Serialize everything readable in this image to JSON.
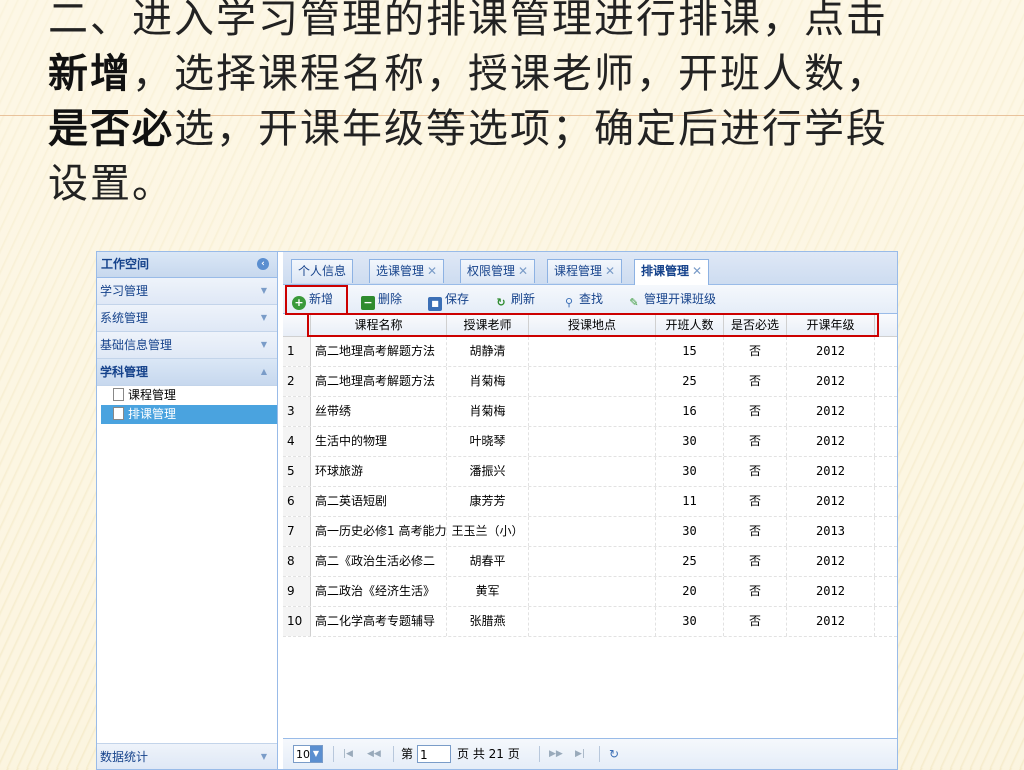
{
  "slide": {
    "line1": "二、进入学习管理的排课管理进行排课，点击",
    "bold_new": "新增",
    "line2_rest": "，选择课程名称，授课老师，开班人数，",
    "bold_required": "是否必",
    "line3_rest": "选，开课年级等选项；确定后进行学段",
    "line4": "设置。"
  },
  "sidebar": {
    "title": "工作空间",
    "sections": [
      {
        "label": "学习管理"
      },
      {
        "label": "系统管理"
      },
      {
        "label": "基础信息管理"
      },
      {
        "label": "学科管理"
      }
    ],
    "items": [
      {
        "label": "课程管理"
      },
      {
        "label": "排课管理"
      }
    ],
    "bottom": "数据统计"
  },
  "tabs": [
    {
      "label": "个人信息"
    },
    {
      "label": "选课管理"
    },
    {
      "label": "权限管理"
    },
    {
      "label": "课程管理"
    },
    {
      "label": "排课管理"
    }
  ],
  "toolbar": {
    "add": "新增",
    "delete": "删除",
    "save": "保存",
    "refresh": "刷新",
    "search": "查找",
    "manage": "管理开课班级"
  },
  "grid": {
    "columns": [
      "课程名称",
      "授课老师",
      "授课地点",
      "开班人数",
      "是否必选",
      "开课年级"
    ],
    "rows": [
      {
        "n": "1",
        "name": "高二地理高考解题方法",
        "teacher": "胡静清",
        "place": "",
        "count": "15",
        "req": "否",
        "grade": "2012"
      },
      {
        "n": "2",
        "name": "高二地理高考解题方法",
        "teacher": "肖菊梅",
        "place": "",
        "count": "25",
        "req": "否",
        "grade": "2012"
      },
      {
        "n": "3",
        "name": "丝带绣",
        "teacher": "肖菊梅",
        "place": "",
        "count": "16",
        "req": "否",
        "grade": "2012"
      },
      {
        "n": "4",
        "name": "生活中的物理",
        "teacher": "叶晓琴",
        "place": "",
        "count": "30",
        "req": "否",
        "grade": "2012"
      },
      {
        "n": "5",
        "name": "环球旅游",
        "teacher": "潘振兴",
        "place": "",
        "count": "30",
        "req": "否",
        "grade": "2012"
      },
      {
        "n": "6",
        "name": "高二英语短剧",
        "teacher": "康芳芳",
        "place": "",
        "count": "11",
        "req": "否",
        "grade": "2012"
      },
      {
        "n": "7",
        "name": "高一历史必修1 高考能力",
        "teacher": "王玉兰（小）",
        "place": "",
        "count": "30",
        "req": "否",
        "grade": "2013"
      },
      {
        "n": "8",
        "name": "高二《政治生活必修二",
        "teacher": "胡春平",
        "place": "",
        "count": "25",
        "req": "否",
        "grade": "2012"
      },
      {
        "n": "9",
        "name": "高二政治《经济生活》",
        "teacher": "黄军",
        "place": "",
        "count": "20",
        "req": "否",
        "grade": "2012"
      },
      {
        "n": "10",
        "name": "高二化学高考专题辅导",
        "teacher": "张腊燕",
        "place": "",
        "count": "30",
        "req": "否",
        "grade": "2012"
      }
    ]
  },
  "pager": {
    "page_size": "10",
    "page_prefix": "第",
    "page_value": "1",
    "page_suffix": "页 共 21 页"
  },
  "colors": {
    "highlight": "#cc0000",
    "accent": "#4aa3df"
  },
  "icons": [
    "add-icon",
    "delete-icon",
    "save-icon",
    "refresh-icon",
    "search-icon",
    "edit-icon",
    "document-icon",
    "chevron-down-icon",
    "collapse-icon",
    "first-page-icon",
    "prev-page-icon",
    "next-page-icon",
    "last-page-icon",
    "reload-icon"
  ]
}
